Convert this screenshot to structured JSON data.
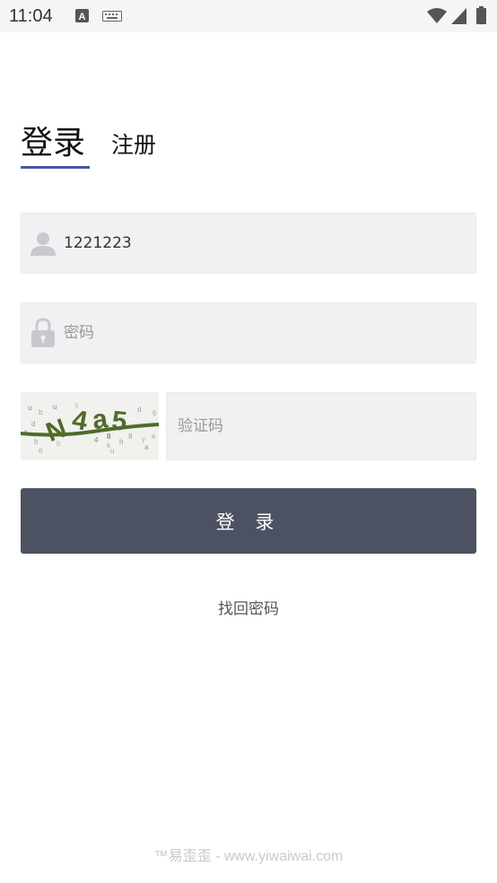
{
  "status_bar": {
    "time": "11:04",
    "icons": [
      "text-a-icon",
      "keyboard-icon",
      "wifi-icon",
      "signal-icon",
      "battery-icon"
    ]
  },
  "tabs": {
    "login": "登录",
    "register": "注册",
    "accent_color": "#4a56a6"
  },
  "form": {
    "username_value": "1221223",
    "password_placeholder": "密码",
    "captcha_placeholder": "验证码",
    "captcha_text": "N4a5"
  },
  "login_button": {
    "label": "登 录",
    "color": "#4d5262"
  },
  "forgot_password": "找回密码",
  "watermark": "™易歪歪 - www.yiwaiwai.com"
}
